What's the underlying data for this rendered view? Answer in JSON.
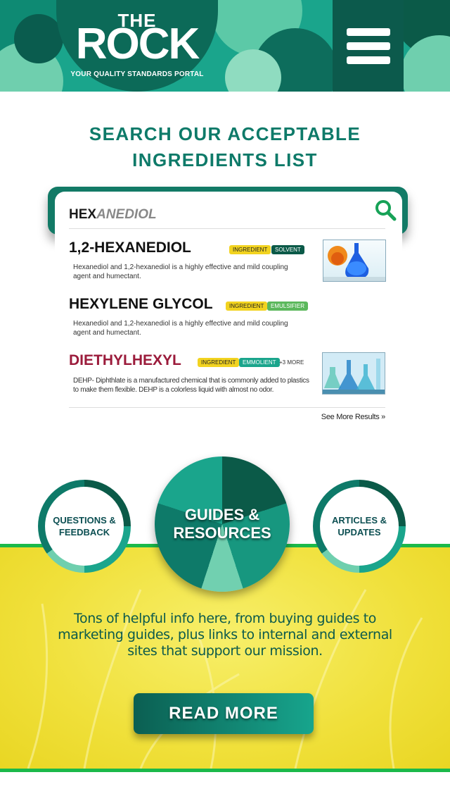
{
  "header": {
    "logo_the": "THE",
    "logo_rock": "ROCK",
    "logo_tagline": "YOUR QUALITY STANDARDS PORTAL",
    "menu_icon": "hamburger-menu-icon"
  },
  "search": {
    "title": "SEARCH OUR ACCEPTABLE INGREDIENTS LIST",
    "query_typed": "HEX",
    "query_completion": "ANEDIOL",
    "icon": "search-icon",
    "results": [
      {
        "title": "1,2-HEXANEDIOL",
        "tags": [
          "INGREDIENT",
          "SOLVENT"
        ],
        "description": "Hexanediol and 1,2-hexanediol is a highly effective and mild coupling agent and humectant."
      },
      {
        "title": "HEXYLENE GLYCOL",
        "tags": [
          "INGREDIENT",
          "EMULSIFIER"
        ],
        "description": "Hexanediol and 1,2-hexanediol is a highly effective and mild coupling agent and humectant."
      },
      {
        "title": "DIETHYLHEXYL",
        "tags": [
          "INGREDIENT",
          "EMMOLIENT"
        ],
        "more": "+3 MORE",
        "description": "DEHP-  Diphthlate is a manufactured chemical that is commonly added to plastics to make them flexible. DEHP is a colorless liquid with almost no odor."
      }
    ],
    "see_more": "See More Results »"
  },
  "sections": {
    "questions": "QUESTIONS & FEEDBACK",
    "guides": "GUIDES & RESOURCES",
    "articles": "ARTICLES & UPDATES"
  },
  "promo": {
    "text": "Tons of helpful info here, from buying guides to marketing guides, plus links to internal and external sites that support our mission.",
    "button": "READ MORE"
  },
  "colors": {
    "brand_teal": "#0e7a69",
    "dark_teal": "#0b5a48",
    "accent_green": "#1bb94a",
    "yellow": "#f0e03a",
    "result_red": "#9b1b3b"
  }
}
